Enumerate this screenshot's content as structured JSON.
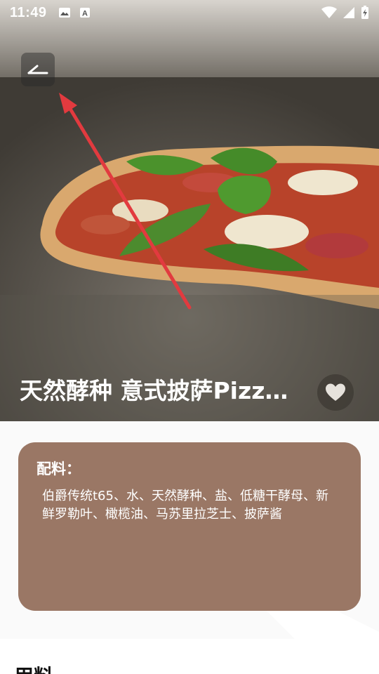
{
  "status_bar": {
    "time": "11:49",
    "left_icons": [
      "image-icon",
      "a-icon"
    ],
    "right_icons": [
      "wifi-icon",
      "signal-icon",
      "battery-charging-icon"
    ]
  },
  "header": {
    "back_icon": "back-arrow-icon"
  },
  "recipe": {
    "title": "天然酵种  意式披萨Pizz…",
    "favorite_icon": "heart-icon"
  },
  "ingredients": {
    "heading": "配料：",
    "text": "伯爵传统t65、水、天然酵种、盐、低糖干酵母、新鲜罗勒叶、橄榄油、马苏里拉芝士、披萨酱"
  },
  "next_section": {
    "heading": "用料"
  },
  "colors": {
    "card_bg": "#9a7765",
    "annotation_arrow": "#e23a3f"
  }
}
